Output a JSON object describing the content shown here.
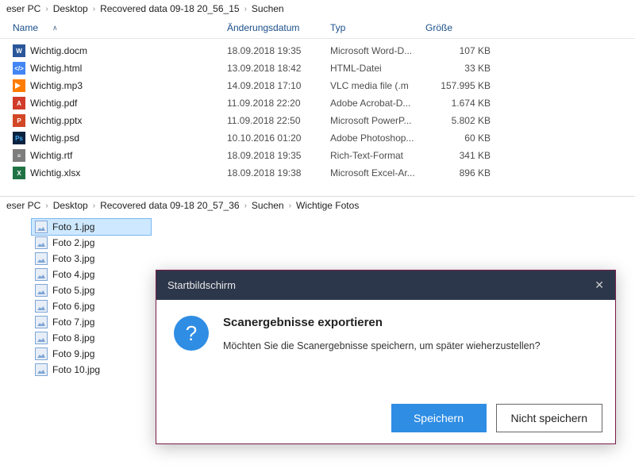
{
  "pane1": {
    "breadcrumb": [
      "eser PC",
      "Desktop",
      "Recovered data 09-18 20_56_15",
      "Suchen"
    ],
    "columns": {
      "name": "Name",
      "date": "Änderungsdatum",
      "type": "Typ",
      "size": "Größe"
    },
    "files": [
      {
        "icon": "icon-docm",
        "badge": "W",
        "name": "Wichtig.docm",
        "date": "18.09.2018 19:35",
        "type": "Microsoft Word-D...",
        "size": "107 KB"
      },
      {
        "icon": "icon-html",
        "badge": "</>",
        "name": "Wichtig.html",
        "date": "13.09.2018 18:42",
        "type": "HTML-Datei",
        "size": "33 KB"
      },
      {
        "icon": "icon-mp3",
        "badge": "",
        "name": "Wichtig.mp3",
        "date": "14.09.2018 17:10",
        "type": "VLC media file (.m",
        "size": "157.995 KB"
      },
      {
        "icon": "icon-pdf",
        "badge": "A",
        "name": "Wichtig.pdf",
        "date": "11.09.2018 22:20",
        "type": "Adobe Acrobat-D...",
        "size": "1.674 KB"
      },
      {
        "icon": "icon-pptx",
        "badge": "P",
        "name": "Wichtig.pptx",
        "date": "11.09.2018 22:50",
        "type": "Microsoft PowerP...",
        "size": "5.802 KB"
      },
      {
        "icon": "icon-psd",
        "badge": "Ps",
        "name": "Wichtig.psd",
        "date": "10.10.2016 01:20",
        "type": "Adobe Photoshop...",
        "size": "60 KB"
      },
      {
        "icon": "icon-rtf",
        "badge": "≡",
        "name": "Wichtig.rtf",
        "date": "18.09.2018 19:35",
        "type": "Rich-Text-Format",
        "size": "341 KB"
      },
      {
        "icon": "icon-xlsx",
        "badge": "X",
        "name": "Wichtig.xlsx",
        "date": "18.09.2018 19:38",
        "type": "Microsoft Excel-Ar...",
        "size": "896 KB"
      }
    ]
  },
  "pane2": {
    "breadcrumb": [
      "eser PC",
      "Desktop",
      "Recovered data 09-18 20_57_36",
      "Suchen",
      "Wichtige Fotos"
    ],
    "photos": [
      "Foto 1.jpg",
      "Foto 2.jpg",
      "Foto 3.jpg",
      "Foto 4.jpg",
      "Foto 5.jpg",
      "Foto 6.jpg",
      "Foto 7.jpg",
      "Foto 8.jpg",
      "Foto 9.jpg",
      "Foto 10.jpg"
    ],
    "selectedIndex": 0
  },
  "dialog": {
    "title": "Startbildschirm",
    "heading": "Scanergebnisse exportieren",
    "text": "Möchten Sie die Scanergebnisse speichern, um später wieherzustellen?",
    "save": "Speichern",
    "dont_save": "Nicht speichern"
  }
}
